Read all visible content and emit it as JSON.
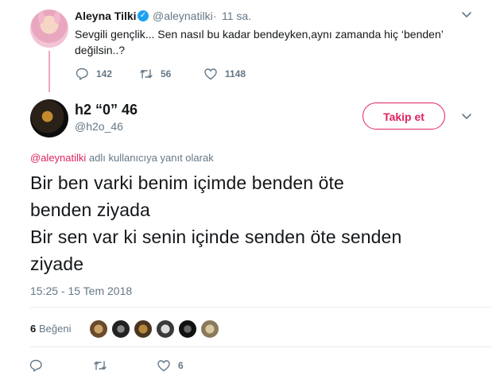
{
  "parent_tweet": {
    "author_name": "Aleyna Tilki",
    "handle": "@aleynatilki",
    "separator": "·",
    "time": "11 sa.",
    "text": "Sevgili gençlik... Sen nasıl bu kadar bendeyken,aynı zamanda hiç ‘benden’ değilsin..?",
    "replies": "142",
    "retweets": "56",
    "likes": "1148"
  },
  "main_tweet": {
    "author_name": "h2 “0” 46",
    "handle": "@h2o_46",
    "follow_label": "Takip et",
    "reply_to_handle": "@aleynatilki",
    "reply_to_suffix": " adlı kullanıcıya yanıt olarak",
    "text_lines": [
      "Bir ben varki benim içimde benden öte",
      "benden ziyada",
      "Bir sen var ki senin içinde senden öte senden",
      "ziyade"
    ],
    "timestamp": "15:25 - 15 Tem 2018",
    "likes_count": "6",
    "likes_label": "Beğeni",
    "footer_like_count": "6"
  },
  "colors": {
    "accent": "#e0245e",
    "muted": "#657786",
    "verified": "#1da1f2",
    "divider": "#e6ecf0"
  },
  "icons": [
    "verified-badge-icon",
    "chevron-down-icon",
    "reply-icon",
    "retweet-icon",
    "heart-icon"
  ]
}
